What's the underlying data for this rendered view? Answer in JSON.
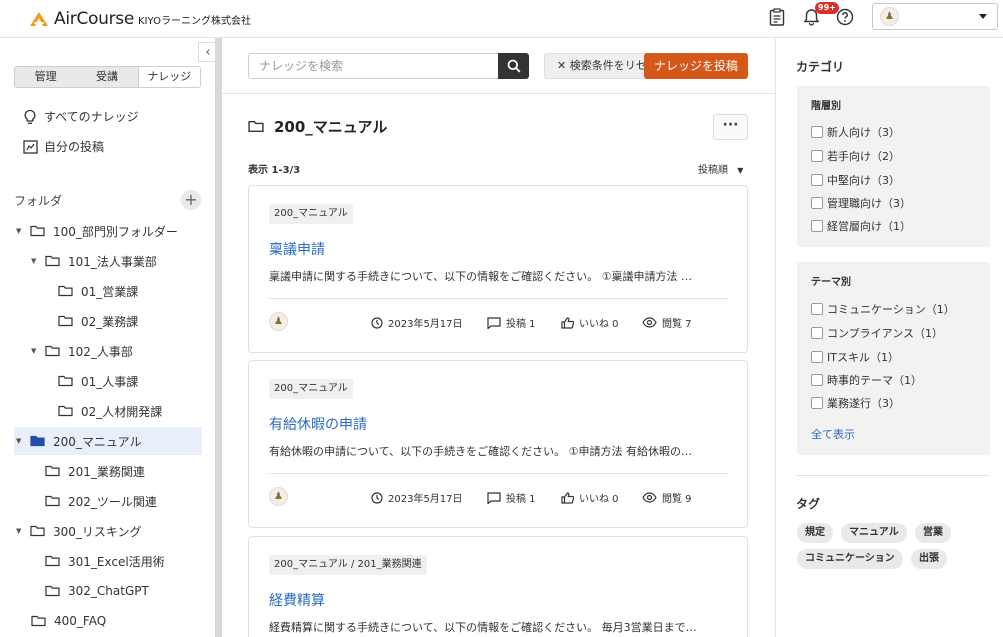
{
  "header": {
    "logo_text": "AirCourse",
    "company": "KIYOラーニング株式会社",
    "notification_badge": "99+",
    "user_name": ""
  },
  "sidebar": {
    "tabs": [
      {
        "label": "管理"
      },
      {
        "label": "受講"
      },
      {
        "label": "ナレッジ"
      }
    ],
    "nav": [
      {
        "label": "すべてのナレッジ"
      },
      {
        "label": "自分の投稿"
      }
    ],
    "folder_section": "フォルダ",
    "folders": [
      {
        "label": "100_部門別フォルダー"
      },
      {
        "label": "101_法人事業部"
      },
      {
        "label": "01_営業課"
      },
      {
        "label": "02_業務課"
      },
      {
        "label": "102_人事部"
      },
      {
        "label": "01_人事課"
      },
      {
        "label": "02_人材開発課"
      },
      {
        "label": "200_マニュアル"
      },
      {
        "label": "201_業務関連"
      },
      {
        "label": "202_ツール関連"
      },
      {
        "label": "300_リスキング"
      },
      {
        "label": "301_Excel活用術"
      },
      {
        "label": "302_ChatGPT"
      },
      {
        "label": "400_FAQ"
      }
    ]
  },
  "main": {
    "search_placeholder": "ナレッジを検索",
    "reset_label": "検索条件をリセット",
    "post_label": "ナレッジを投稿",
    "title": "200_マニュアル",
    "count": "表示 1-3/3",
    "sort": "投稿順",
    "cards": [
      {
        "crumb": "200_マニュアル",
        "title": "稟議申請",
        "desc": "稟議申請に関する手続きについて、以下の情報をご確認ください。 ①稟議申請方法 …",
        "date": "2023年5月17日",
        "posts": "投稿 1",
        "likes": "いいね 0",
        "views": "閲覧 7"
      },
      {
        "crumb": "200_マニュアル",
        "title": "有給休暇の申請",
        "desc": "有給休暇の申請について、以下の手続きをご確認ください。 ①申請方法 有給休暇の…",
        "date": "2023年5月17日",
        "posts": "投稿 1",
        "likes": "いいね 0",
        "views": "閲覧 9"
      },
      {
        "crumb": "200_マニュアル / 201_業務関連",
        "title": "経費精算",
        "desc": "経費精算に関する手続きについて、以下の情報をご確認ください。 毎月3営業日まで…"
      }
    ]
  },
  "right": {
    "category_title": "カテゴリ",
    "level_title": "階層別",
    "levels": [
      {
        "label": "新人向け（3）"
      },
      {
        "label": "若手向け（2）"
      },
      {
        "label": "中堅向け（3）"
      },
      {
        "label": "管理職向け（3）"
      },
      {
        "label": "経営層向け（1）"
      }
    ],
    "theme_title": "テーマ別",
    "themes": [
      {
        "label": "コミュニケーション（1）"
      },
      {
        "label": "コンプライアンス（1）"
      },
      {
        "label": "ITスキル（1）"
      },
      {
        "label": "時事的テーマ（1）"
      },
      {
        "label": "業務遂行（3）"
      }
    ],
    "show_all": "全て表示",
    "tag_title": "タグ",
    "tags": [
      {
        "label": "規定"
      },
      {
        "label": "マニュアル"
      },
      {
        "label": "営業"
      },
      {
        "label": "コミュニケーション"
      },
      {
        "label": "出張"
      }
    ]
  },
  "colors": {
    "accent": "#d4581a",
    "link": "#2b6cc4",
    "active_folder_bg": "#e8effb",
    "active_folder_icon": "#1f4fa8"
  }
}
